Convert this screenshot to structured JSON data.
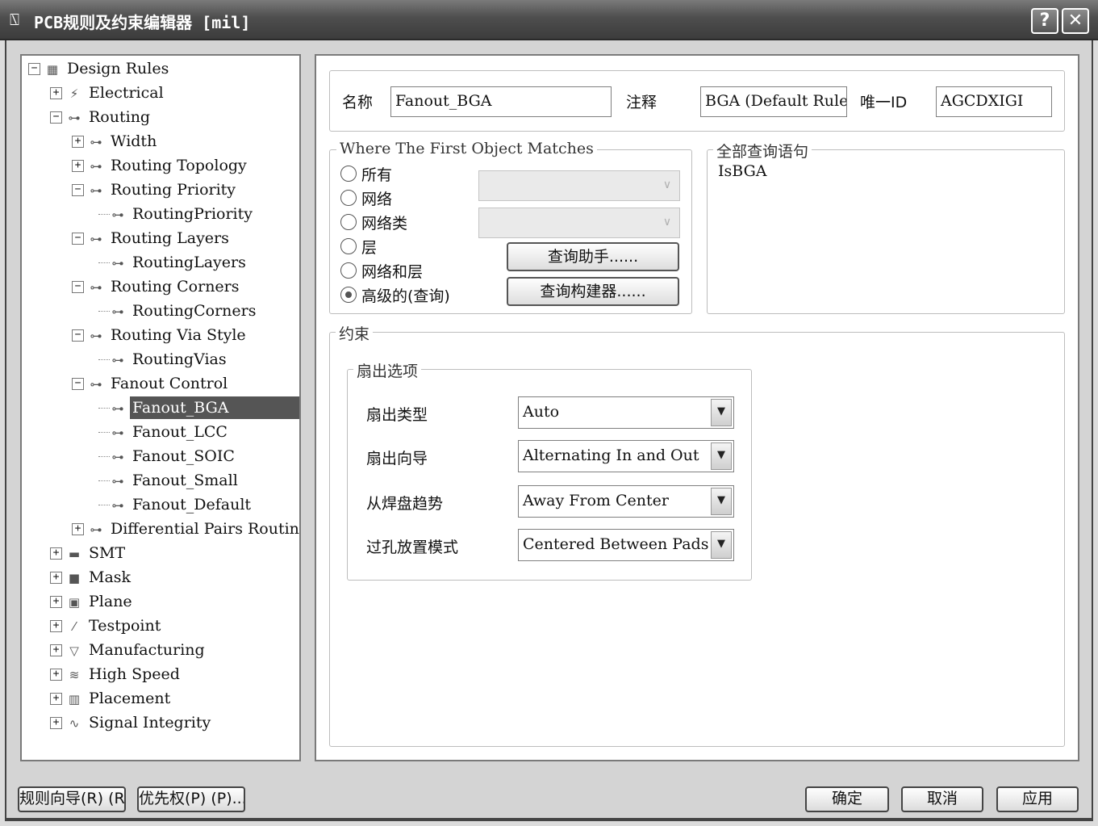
{
  "window": {
    "title": "PCB规则及约束编辑器 [mil]",
    "help_glyph": "?",
    "close_glyph": "✕",
    "icon": "app-icon"
  },
  "tree": {
    "items": [
      {
        "label": "Design Rules",
        "level": 0,
        "expander": "−",
        "icon": "▦"
      },
      {
        "label": "Electrical",
        "level": 1,
        "expander": "+",
        "icon": "⚡"
      },
      {
        "label": "Routing",
        "level": 1,
        "expander": "−",
        "icon": "⊶"
      },
      {
        "label": "Width",
        "level": 2,
        "expander": "+",
        "icon": "⊶"
      },
      {
        "label": "Routing Topology",
        "level": 2,
        "expander": "+",
        "icon": "⊶"
      },
      {
        "label": "Routing Priority",
        "level": 2,
        "expander": "−",
        "icon": "⊶"
      },
      {
        "label": "RoutingPriority",
        "level": 3,
        "expander": "",
        "icon": "⊶"
      },
      {
        "label": "Routing Layers",
        "level": 2,
        "expander": "−",
        "icon": "⊶"
      },
      {
        "label": "RoutingLayers",
        "level": 3,
        "expander": "",
        "icon": "⊶"
      },
      {
        "label": "Routing Corners",
        "level": 2,
        "expander": "−",
        "icon": "⊶"
      },
      {
        "label": "RoutingCorners",
        "level": 3,
        "expander": "",
        "icon": "⊶"
      },
      {
        "label": "Routing Via Style",
        "level": 2,
        "expander": "−",
        "icon": "⊶"
      },
      {
        "label": "RoutingVias",
        "level": 3,
        "expander": "",
        "icon": "⊶"
      },
      {
        "label": "Fanout Control",
        "level": 2,
        "expander": "−",
        "icon": "⊶"
      },
      {
        "label": "Fanout_BGA",
        "level": 3,
        "expander": "",
        "icon": "⊶",
        "selected": true
      },
      {
        "label": "Fanout_LCC",
        "level": 3,
        "expander": "",
        "icon": "⊶"
      },
      {
        "label": "Fanout_SOIC",
        "level": 3,
        "expander": "",
        "icon": "⊶"
      },
      {
        "label": "Fanout_Small",
        "level": 3,
        "expander": "",
        "icon": "⊶"
      },
      {
        "label": "Fanout_Default",
        "level": 3,
        "expander": "",
        "icon": "⊶"
      },
      {
        "label": "Differential Pairs Routing",
        "level": 2,
        "expander": "+",
        "icon": "⊶"
      },
      {
        "label": "SMT",
        "level": 1,
        "expander": "+",
        "icon": "▬"
      },
      {
        "label": "Mask",
        "level": 1,
        "expander": "+",
        "icon": "■"
      },
      {
        "label": "Plane",
        "level": 1,
        "expander": "+",
        "icon": "▣"
      },
      {
        "label": "Testpoint",
        "level": 1,
        "expander": "+",
        "icon": "⁄"
      },
      {
        "label": "Manufacturing",
        "level": 1,
        "expander": "+",
        "icon": "▽"
      },
      {
        "label": "High Speed",
        "level": 1,
        "expander": "+",
        "icon": "≋"
      },
      {
        "label": "Placement",
        "level": 1,
        "expander": "+",
        "icon": "▥"
      },
      {
        "label": "Signal Integrity",
        "level": 1,
        "expander": "+",
        "icon": "∿"
      }
    ]
  },
  "rule": {
    "name_label": "名称",
    "name_value": "Fanout_BGA",
    "comment_label": "注释",
    "comment_value": "BGA (Default Rule)",
    "uid_label": "唯一ID",
    "uid_value": "AGCDXIGI"
  },
  "match": {
    "legend": "Where The First Object Matches",
    "options": [
      "所有",
      "网络",
      "网络类",
      "层",
      "网络和层",
      "高级的(查询)"
    ],
    "selected_index": 5,
    "query_helper_button": "查询助手......",
    "query_builder_button": "查询构建器......"
  },
  "full_query": {
    "legend": "全部查询语句",
    "text": "IsBGA"
  },
  "constraints": {
    "legend": "约束",
    "options_legend": "扇出选项",
    "rows": [
      {
        "label": "扇出类型",
        "value": "Auto"
      },
      {
        "label": "扇出向导",
        "value": "Alternating In and Out"
      },
      {
        "label": "从焊盘趋势",
        "value": "Away From Center"
      },
      {
        "label": "过孔放置模式",
        "value": "Centered Between Pads"
      }
    ],
    "dropdown_glyph": "▼"
  },
  "footer": {
    "wizard_button": "规则向导(R) (R)...",
    "priority_button": "优先权(P) (P)...",
    "ok_button": "确定",
    "cancel_button": "取消",
    "apply_button": "应用"
  }
}
